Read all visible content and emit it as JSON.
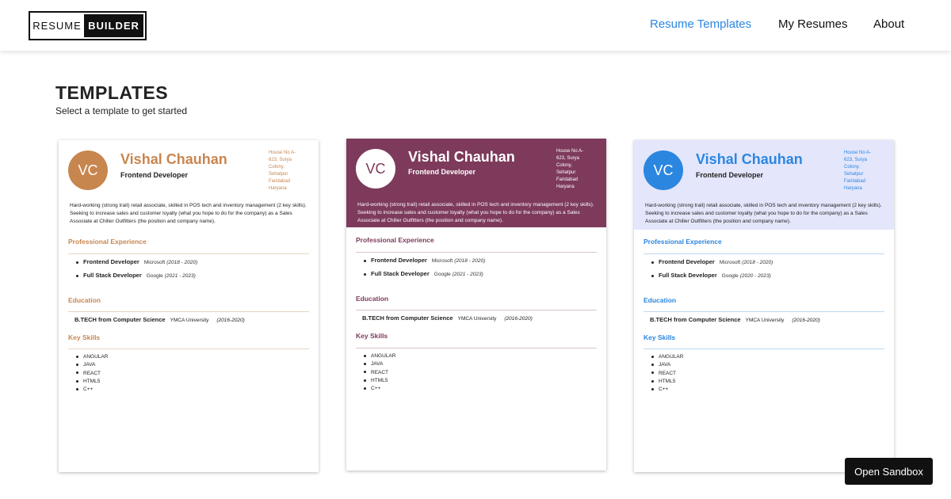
{
  "logo": {
    "part1": "RESUME",
    "part2": "BUILDER"
  },
  "nav": [
    {
      "label": "Resume Templates"
    },
    {
      "label": "My Resumes"
    },
    {
      "label": "About"
    }
  ],
  "page": {
    "title": "TEMPLATES",
    "subtitle": "Select a template to get started"
  },
  "colors": {
    "accent": "#2b86e0",
    "template1": "#c8864f",
    "template2": "#7d3a5b",
    "template3": "#2b86e0"
  },
  "templates": [
    {
      "initials": "VC",
      "name": "Vishal Chauhan",
      "role": "Frontend Developer",
      "address": [
        "House No A-",
        "623, Surya",
        "Colony,",
        "Sehatpur",
        "Faridabad",
        "Haryana"
      ],
      "summary": "Hard-working (strong trait) retail associate, skilled in POS tech and inventory management (2 key skills). Seeking to increase sales and customer loyalty (what you hope to do for the company) as a Sales Associate at Chiller Outfitters (the position and company name).",
      "exp_title": "Professional Experience",
      "experience": [
        {
          "title": "Frontend Developer",
          "company": "Microsoft",
          "dates": "(2018 - 2020)"
        },
        {
          "title": "Full Stack Developer",
          "company": "Google",
          "dates": "(2021 - 2023)"
        }
      ],
      "edu_title": "Education",
      "education": {
        "degree": "B.TECH from Computer Science",
        "school": "YMCA University",
        "dates": "(2016-2020)"
      },
      "skills_title": "Key Skills",
      "skills": [
        "ANGULAR",
        "JAVA",
        "REACT",
        "HTML5",
        "C++"
      ]
    },
    {
      "initials": "VC",
      "name": "Vishal Chauhan",
      "role": "Frontend Developer",
      "address": [
        "House No A-",
        "623, Surya",
        "Colony,",
        "Sehatpur",
        "Faridabad",
        "Haryana"
      ],
      "summary": "Hard-working (strong trait) retail associate, skilled in POS tech and inventory management (2 key skills). Seeking to increase sales and customer loyalty (what you hope to do for the company) as a Sales Associate at Chiller Outfitters (the position and company name).",
      "exp_title": "Professional Experience",
      "experience": [
        {
          "title": "Frontend Developer",
          "company": "Microsoft",
          "dates": "(2018 - 2020)"
        },
        {
          "title": "Full Stack Developer",
          "company": "Google",
          "dates": "(2021 - 2023)"
        }
      ],
      "edu_title": "Education",
      "education": {
        "degree": "B.TECH from Computer Science",
        "school": "YMCA University",
        "dates": "(2016-2020)"
      },
      "skills_title": "Key Skills",
      "skills": [
        "ANGULAR",
        "JAVA",
        "REACT",
        "HTML5",
        "C++"
      ]
    },
    {
      "initials": "VC",
      "name": "Vishal Chauhan",
      "role": "Frontend Developer",
      "address": [
        "House No A-",
        "623, Surya",
        "Colony,",
        "Sehatpur",
        "Faridabad",
        "Haryana"
      ],
      "summary": "Hard-working (strong trait) retail associate, skilled in POS tech and inventory management (2 key skills). Seeking to increase sales and customer loyalty (what you hope to do for the company) as a Sales Associate at Chiller Outfitters (the position and company name).",
      "exp_title": "Professional Experience",
      "experience": [
        {
          "title": "Frontend Developer",
          "company": "Microsoft",
          "dates": "(2018 - 2020)"
        },
        {
          "title": "Full Stack Developer",
          "company": "Google",
          "dates": "(2020 - 2023)"
        }
      ],
      "edu_title": "Education",
      "education": {
        "degree": "B.TECH from Computer Science",
        "school": "YMCA University",
        "dates": "(2016-2020)"
      },
      "skills_title": "Key Skills",
      "skills": [
        "ANGULAR",
        "JAVA",
        "REACT",
        "HTML5",
        "C++"
      ]
    }
  ],
  "sandbox": {
    "label": "Open Sandbox"
  }
}
